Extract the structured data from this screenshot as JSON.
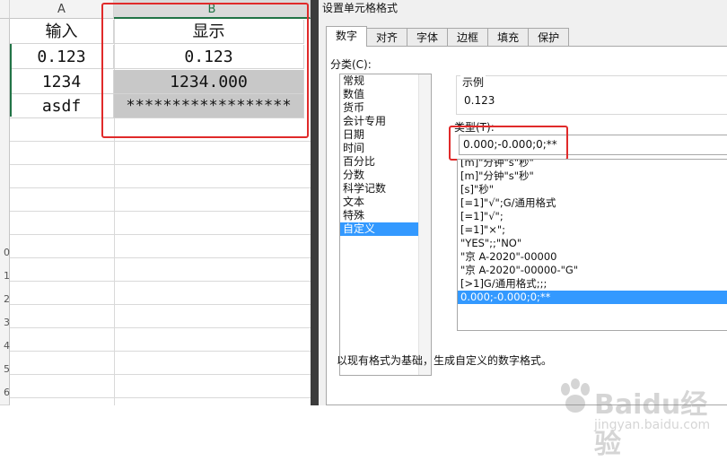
{
  "sheet": {
    "columns": [
      {
        "label": "A"
      },
      {
        "label": "B"
      }
    ],
    "rows": [
      {
        "a": "输入",
        "b": "显示"
      },
      {
        "a": "0.123",
        "b": "0.123"
      },
      {
        "a": "1234",
        "b": "1234.000"
      },
      {
        "a": "asdf",
        "b": "******************"
      }
    ],
    "row_numbers": [
      "0",
      "1",
      "2",
      "3",
      "4",
      "5",
      "6"
    ]
  },
  "dialog": {
    "title": "设置单元格格式",
    "tabs": [
      "数字",
      "对齐",
      "字体",
      "边框",
      "填充",
      "保护"
    ],
    "active_tab": "数字",
    "category_label": "分类(C):",
    "categories": [
      "常规",
      "数值",
      "货币",
      "会计专用",
      "日期",
      "时间",
      "百分比",
      "分数",
      "科学记数",
      "文本",
      "特殊",
      "自定义"
    ],
    "selected_category": "自定义",
    "sample_label": "示例",
    "sample_value": "0.123",
    "type_label": "类型(T):",
    "type_value": "0.000;-0.000;0;**",
    "formats": [
      "[m]\"分钟\"s\"秒\"",
      "[m]\"分钟\"s\"秒\"",
      "[s]\"秒\"",
      "[=1]\"√\";G/通用格式",
      "[=1]\"√\";",
      "[=1]\"×\";",
      "\"YES\";;\"NO\"",
      "\"京 A-2020\"-00000",
      "\"京 A-2020\"-00000-\"G\"",
      "[>1]G/通用格式;;;",
      "0.000;-0.000;0;**"
    ],
    "selected_format": "0.000;-0.000;0;**",
    "description": "以现有格式为基础，生成自定义的数字格式。"
  },
  "watermark": {
    "brand": "Baidu经验",
    "sub": "jingyan.baidu.com"
  },
  "colors": {
    "highlight": "#e02a2a",
    "selection": "#3399ff",
    "excel_green": "#217346"
  }
}
